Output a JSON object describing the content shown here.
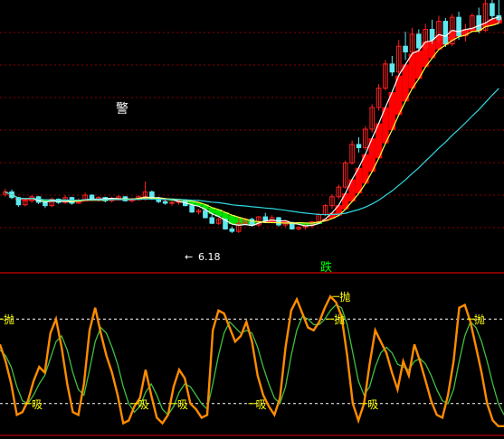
{
  "colors": {
    "background": "#000000",
    "grid": "#8B0000",
    "candle_up": "#FF2020",
    "candle_down": "#5FE8F0",
    "ma_short": "#FFFFFF",
    "ma_mid": "#FFFF40",
    "ma_long": "#30D8E0",
    "band_rise": "#FF0000",
    "band_fall": "#00E000",
    "osc_fast": "#FF8C00",
    "osc_slow": "#40C040",
    "threshold": "#FFFFFF",
    "text_yellow": "#FFFF00",
    "text_white": "#FFFFFF",
    "text_green": "#00FF00",
    "divider": "#B00000"
  },
  "labels": {
    "warning": "警",
    "low_price": "6.18",
    "low_arrow": "←",
    "fall_mark": "跌",
    "sell_mark": "抛",
    "buy_mark": "吸"
  },
  "chart_data": [
    {
      "type": "candlestick",
      "ohlc": [
        [
          7.86,
          8.0,
          7.8,
          7.92
        ],
        [
          7.92,
          7.98,
          7.74,
          7.78
        ],
        [
          7.78,
          7.8,
          7.55,
          7.6
        ],
        [
          7.6,
          7.72,
          7.56,
          7.7
        ],
        [
          7.7,
          7.84,
          7.65,
          7.8
        ],
        [
          7.8,
          7.82,
          7.62,
          7.66
        ],
        [
          7.66,
          7.7,
          7.52,
          7.58
        ],
        [
          7.58,
          7.78,
          7.54,
          7.74
        ],
        [
          7.74,
          7.76,
          7.62,
          7.66
        ],
        [
          7.66,
          7.84,
          7.62,
          7.78
        ],
        [
          7.78,
          7.8,
          7.6,
          7.64
        ],
        [
          7.64,
          7.76,
          7.62,
          7.72
        ],
        [
          7.72,
          7.9,
          7.7,
          7.84
        ],
        [
          7.84,
          7.86,
          7.7,
          7.72
        ],
        [
          7.72,
          7.82,
          7.68,
          7.78
        ],
        [
          7.78,
          7.8,
          7.66,
          7.7
        ],
        [
          7.7,
          7.8,
          7.66,
          7.76
        ],
        [
          7.76,
          7.84,
          7.72,
          7.8
        ],
        [
          7.8,
          7.82,
          7.68,
          7.7
        ],
        [
          7.7,
          7.78,
          7.66,
          7.74
        ],
        [
          7.74,
          7.84,
          7.7,
          7.8
        ],
        [
          7.8,
          8.18,
          7.7,
          7.92
        ],
        [
          7.92,
          7.96,
          7.72,
          7.74
        ],
        [
          7.74,
          7.8,
          7.64,
          7.68
        ],
        [
          7.68,
          7.72,
          7.6,
          7.64
        ],
        [
          7.64,
          7.7,
          7.58,
          7.66
        ],
        [
          7.66,
          7.74,
          7.6,
          7.7
        ],
        [
          7.7,
          7.72,
          7.56,
          7.58
        ],
        [
          7.58,
          7.64,
          7.4,
          7.42
        ],
        [
          7.42,
          7.5,
          7.36,
          7.46
        ],
        [
          7.46,
          7.48,
          7.26,
          7.28
        ],
        [
          7.28,
          7.36,
          7.12,
          7.14
        ],
        [
          7.14,
          7.28,
          7.1,
          7.24
        ],
        [
          7.24,
          7.26,
          6.98,
          7.0
        ],
        [
          7.0,
          7.06,
          6.9,
          6.94
        ],
        [
          6.94,
          7.3,
          6.9,
          7.14
        ],
        [
          7.14,
          7.28,
          7.1,
          7.24
        ],
        [
          7.24,
          7.28,
          7.06,
          7.1
        ],
        [
          7.1,
          7.32,
          7.06,
          7.3
        ],
        [
          7.3,
          7.4,
          7.16,
          7.2
        ],
        [
          7.2,
          7.34,
          7.14,
          7.28
        ],
        [
          7.28,
          7.3,
          7.06,
          7.1
        ],
        [
          7.1,
          7.2,
          7.04,
          7.16
        ],
        [
          7.16,
          7.18,
          6.98,
          7.0
        ],
        [
          7.0,
          7.08,
          6.96,
          7.04
        ],
        [
          7.04,
          7.12,
          6.98,
          7.08
        ],
        [
          7.08,
          7.2,
          7.02,
          7.18
        ],
        [
          7.18,
          7.4,
          7.14,
          7.36
        ],
        [
          7.36,
          7.62,
          7.32,
          7.58
        ],
        [
          7.58,
          7.86,
          7.5,
          7.8
        ],
        [
          7.8,
          8.1,
          7.74,
          8.04
        ],
        [
          8.04,
          8.7,
          8.0,
          8.64
        ],
        [
          8.64,
          9.2,
          8.6,
          9.1
        ],
        [
          9.1,
          9.28,
          8.9,
          9.02
        ],
        [
          9.02,
          9.56,
          8.96,
          9.48
        ],
        [
          9.48,
          10.1,
          9.4,
          10.02
        ],
        [
          10.02,
          10.6,
          9.94,
          10.5
        ],
        [
          10.5,
          11.2,
          10.44,
          11.1
        ],
        [
          11.1,
          11.3,
          10.8,
          10.9
        ],
        [
          10.9,
          11.7,
          10.84,
          11.54
        ],
        [
          11.54,
          11.9,
          11.2,
          11.4
        ],
        [
          11.4,
          12.0,
          11.3,
          11.84
        ],
        [
          11.84,
          11.96,
          11.4,
          11.5
        ],
        [
          11.5,
          12.1,
          11.44,
          11.96
        ],
        [
          11.96,
          12.2,
          11.6,
          11.7
        ],
        [
          11.7,
          12.3,
          11.62,
          12.16
        ],
        [
          12.16,
          12.24,
          11.52,
          11.6
        ],
        [
          11.6,
          12.34,
          11.54,
          12.26
        ],
        [
          12.26,
          12.4,
          11.7,
          11.8
        ],
        [
          11.8,
          12.1,
          11.66,
          11.96
        ],
        [
          11.96,
          12.36,
          11.9,
          12.3
        ],
        [
          12.3,
          12.5,
          11.86,
          11.94
        ],
        [
          11.94,
          12.7,
          11.9,
          12.6
        ],
        [
          12.6,
          13.2,
          12.2,
          12.3
        ],
        [
          12.3,
          12.7,
          12.1,
          12.2
        ]
      ],
      "overlay_lines": [
        "ma_short",
        "ma_mid",
        "ma_long"
      ],
      "annotations": [
        {
          "text": "警",
          "at_index": 21
        },
        {
          "text": "6.18",
          "at_index": 34
        }
      ]
    },
    {
      "type": "line",
      "series": [
        {
          "name": "fast",
          "values": [
            62,
            50,
            34,
            12,
            14,
            22,
            36,
            46,
            42,
            70,
            80,
            60,
            34,
            14,
            12,
            34,
            72,
            88,
            70,
            54,
            42,
            26,
            6,
            8,
            18,
            24,
            44,
            26,
            10,
            6,
            12,
            32,
            44,
            38,
            20,
            16,
            10,
            12,
            72,
            86,
            84,
            74,
            64,
            68,
            78,
            64,
            40,
            26,
            18,
            12,
            24,
            60,
            86,
            94,
            84,
            74,
            72,
            78,
            88,
            96,
            92,
            82,
            54,
            20,
            8,
            20,
            48,
            72,
            64,
            56,
            42,
            30,
            50,
            40,
            62,
            50,
            36,
            22,
            12,
            10,
            26,
            50,
            88,
            90,
            78,
            60,
            42,
            20,
            8,
            4,
            4
          ]
        },
        {
          "name": "slow",
          "values": [
            58,
            54,
            46,
            32,
            22,
            20,
            26,
            34,
            40,
            52,
            64,
            68,
            58,
            42,
            30,
            26,
            44,
            64,
            74,
            70,
            60,
            48,
            32,
            20,
            14,
            18,
            28,
            34,
            26,
            16,
            12,
            18,
            28,
            34,
            32,
            26,
            20,
            16,
            34,
            54,
            70,
            78,
            74,
            70,
            72,
            70,
            60,
            46,
            34,
            24,
            20,
            32,
            54,
            72,
            82,
            80,
            76,
            76,
            80,
            86,
            90,
            88,
            76,
            56,
            36,
            26,
            32,
            46,
            56,
            60,
            56,
            48,
            46,
            44,
            50,
            52,
            48,
            40,
            30,
            22,
            20,
            30,
            50,
            68,
            78,
            74,
            64,
            50,
            34,
            20,
            12
          ]
        }
      ],
      "ylim": [
        0,
        100
      ],
      "thresholds": [
        80,
        20
      ],
      "annotations": [
        {
          "text": "抛",
          "at_index": 0,
          "level": 80
        },
        {
          "text": "吸",
          "at_index": 5,
          "level": 20
        },
        {
          "text": "吸",
          "at_index": 24,
          "level": 20
        },
        {
          "text": "吸",
          "at_index": 31,
          "level": 20
        },
        {
          "text": "吸",
          "at_index": 45,
          "level": 20
        },
        {
          "text": "抛",
          "at_index": 59,
          "level": 80
        },
        {
          "text": "抛",
          "at_index": 60,
          "level": 96
        },
        {
          "text": "吸",
          "at_index": 65,
          "level": 20
        },
        {
          "text": "抛",
          "at_index": 84,
          "level": 80
        }
      ]
    }
  ]
}
